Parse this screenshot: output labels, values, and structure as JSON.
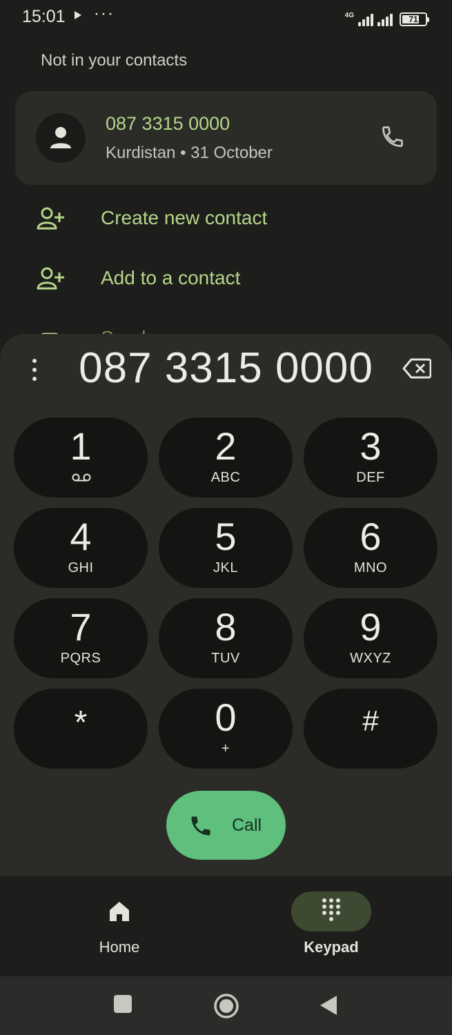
{
  "status_bar": {
    "time": "15:01",
    "network": "4G",
    "battery": "71"
  },
  "recent": {
    "section_title": "Not in your contacts",
    "number": "087 3315 0000",
    "location": "Kurdistan",
    "separator": "•",
    "date": "31 October"
  },
  "actions": [
    {
      "label": "Create new contact",
      "icon": "add-person-icon"
    },
    {
      "label": "Add to a contact",
      "icon": "add-person-icon"
    },
    {
      "label": "Send a message",
      "icon": "message-icon"
    }
  ],
  "dialer": {
    "number": "087 3315 0000",
    "keys": [
      {
        "digit": "1",
        "letters": "",
        "sub_icon": "voicemail-icon"
      },
      {
        "digit": "2",
        "letters": "ABC"
      },
      {
        "digit": "3",
        "letters": "DEF"
      },
      {
        "digit": "4",
        "letters": "GHI"
      },
      {
        "digit": "5",
        "letters": "JKL"
      },
      {
        "digit": "6",
        "letters": "MNO"
      },
      {
        "digit": "7",
        "letters": "PQRS"
      },
      {
        "digit": "8",
        "letters": "TUV"
      },
      {
        "digit": "9",
        "letters": "WXYZ"
      },
      {
        "digit": "*",
        "letters": ""
      },
      {
        "digit": "0",
        "letters": "+"
      },
      {
        "digit": "#",
        "letters": ""
      }
    ],
    "call_label": "Call"
  },
  "bottom_nav": {
    "items": [
      {
        "label": "Home",
        "icon": "home-icon",
        "active": false
      },
      {
        "label": "Keypad",
        "icon": "dialpad-icon",
        "active": true
      }
    ]
  },
  "colors": {
    "accent_green": "#b6d68a",
    "call_button": "#5ec07c",
    "background": "#1d1e1b",
    "dialer_surface": "#2b2c28",
    "key_background": "#141512"
  }
}
